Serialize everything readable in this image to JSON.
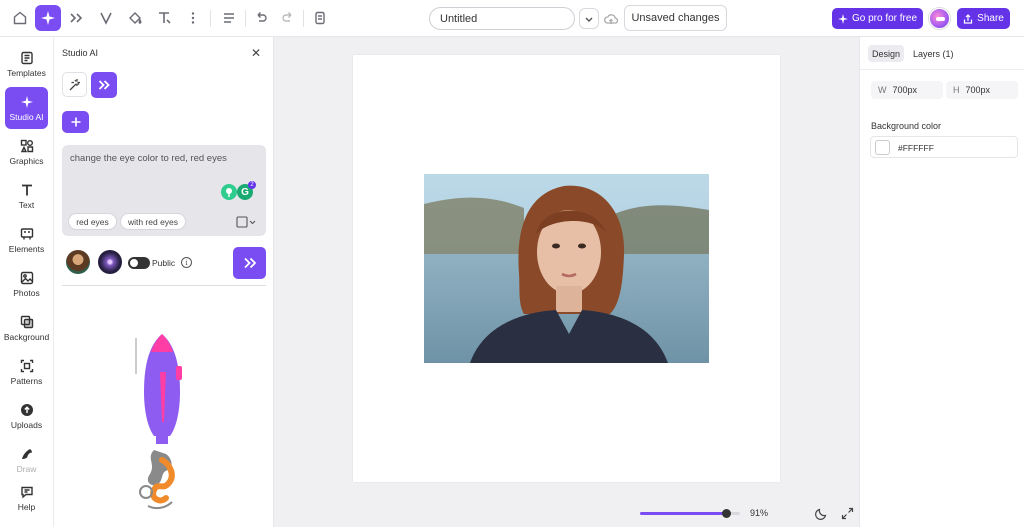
{
  "topbar": {
    "title_value": "Untitled",
    "unsaved_label": "Unsaved changes",
    "gopro_label": "Go pro for free",
    "share_label": "Share"
  },
  "leftnav": {
    "items": [
      {
        "label": "Templates",
        "icon": "templates-icon"
      },
      {
        "label": "Studio AI",
        "icon": "sparkle-icon"
      },
      {
        "label": "Graphics",
        "icon": "graphics-icon"
      },
      {
        "label": "Text",
        "icon": "text-icon"
      },
      {
        "label": "Elements",
        "icon": "elements-icon"
      },
      {
        "label": "Photos",
        "icon": "photos-icon"
      },
      {
        "label": "Background",
        "icon": "background-icon"
      },
      {
        "label": "Patterns",
        "icon": "patterns-icon"
      },
      {
        "label": "Uploads",
        "icon": "uploads-icon"
      },
      {
        "label": "Draw",
        "icon": "draw-icon"
      },
      {
        "label": "Help",
        "icon": "help-icon"
      }
    ]
  },
  "studio": {
    "title": "Studio AI",
    "prompt_text": "change the eye color to red, red eyes",
    "grammarly_count": "2",
    "chips": [
      "red eyes",
      "with red eyes"
    ],
    "public_label": "Public",
    "info_glyph": "i"
  },
  "canvas": {
    "zoom_label": "91%",
    "zoom_fraction": 0.91
  },
  "rightpanel": {
    "tabs": [
      "Design",
      "Layers (1)"
    ],
    "width_key": "W",
    "width_value": "700px",
    "height_key": "H",
    "height_value": "700px",
    "bg_label": "Background color",
    "bg_hex": "#FFFFFF"
  },
  "colors": {
    "accent": "#7a4df3",
    "pro": "#6433e8"
  }
}
